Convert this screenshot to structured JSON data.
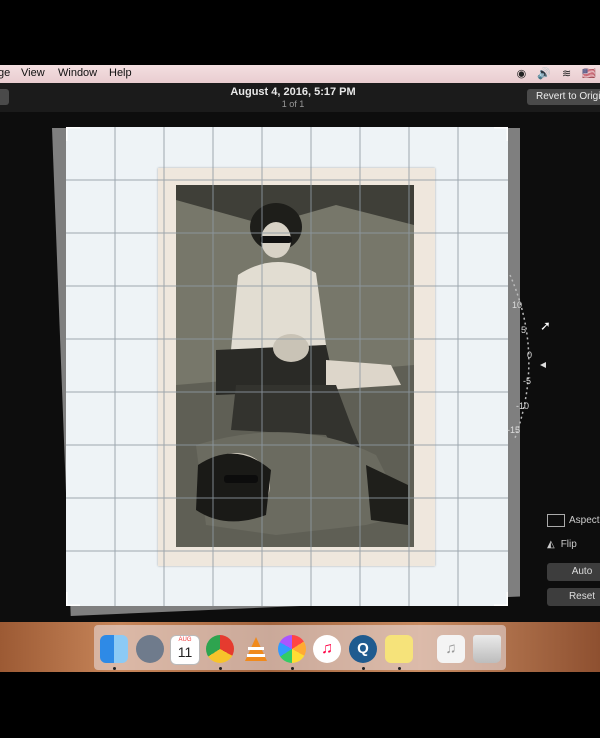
{
  "menubar": {
    "items": [
      "ge",
      "View",
      "Window",
      "Help"
    ],
    "flag": "🇺🇸"
  },
  "toolbar": {
    "title": "August 4, 2016, 5:17 PM",
    "subtitle": "1 of 1",
    "revert_label": "Revert to Original"
  },
  "rotation_dial": {
    "ticks": [
      "10",
      "5",
      "0",
      "-5",
      "-10",
      "-15"
    ]
  },
  "right_panel": {
    "aspect_label": "Aspect",
    "flip_label": "Flip",
    "auto_label": "Auto",
    "reset_label": "Reset"
  },
  "dock": {
    "calendar_month": "AUG",
    "calendar_day": "11"
  },
  "colors": {
    "menubar": "#f0d8da",
    "toolbar": "#1b1b1b",
    "grid_bg": "#eef3f6",
    "dock_wood": "#b87448"
  }
}
